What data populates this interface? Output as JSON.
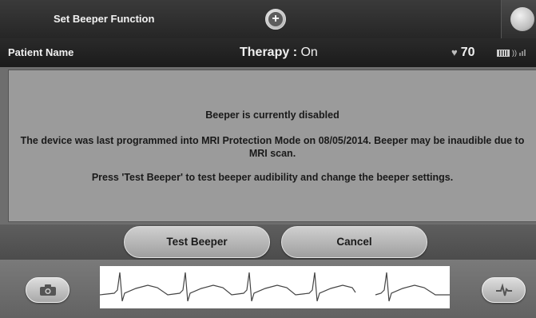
{
  "header": {
    "title": "Set Beeper Function",
    "plus_icon": "plus-circle-icon",
    "corner_icon": "wand-icon"
  },
  "status": {
    "patient": "Patient Name",
    "therapy_label": "Therapy :",
    "therapy_value": "On",
    "heart_rate": "70",
    "icons": [
      "heart-icon",
      "battery-icon",
      "signal-icon"
    ]
  },
  "message": {
    "line1": "Beeper is currently disabled",
    "line2": "The device was last programmed into MRI Protection Mode on 08/05/2014. Beeper may be inaudible due to MRI scan.",
    "line3": "Press 'Test Beeper' to test beeper audibility and change the beeper settings."
  },
  "buttons": {
    "test_beeper": "Test Beeper",
    "cancel": "Cancel"
  },
  "footer": {
    "left_icon": "camera-icon",
    "right_icon": "ecg-pulse-icon",
    "strip_icon": "ecg-strip"
  }
}
